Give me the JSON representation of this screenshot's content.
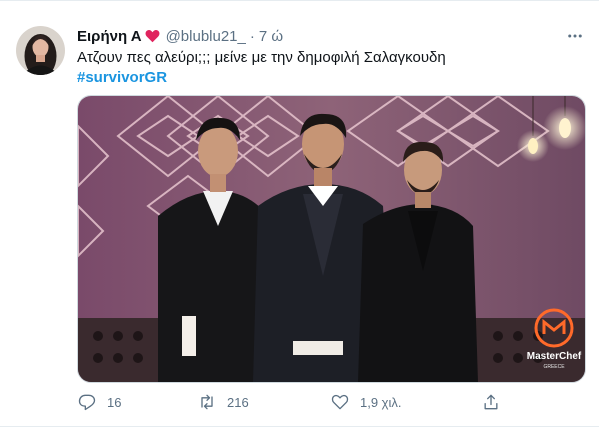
{
  "tweet": {
    "author_name": "Ειρήνη Α",
    "handle": "@blublu21_",
    "separator": "·",
    "time": "7 ώ",
    "text": "Ατζουν πες αλεύρι;;; μείνε με την δημοφιλή Σαλαγκουδη",
    "hashtag": "#survivorGR",
    "media": {
      "logo_title": "MasterChef",
      "logo_subtitle": "GREECE"
    }
  },
  "actions": {
    "replies": "16",
    "retweets": "216",
    "likes": "1,9 χιλ."
  },
  "icons": {
    "heart_emoji": "heart-icon",
    "more": "more-icon",
    "reply": "reply-icon",
    "retweet": "retweet-icon",
    "like": "like-icon",
    "share": "share-icon"
  },
  "colors": {
    "hashtag": "#1b95e0",
    "secondary_text": "#5b7083",
    "heart": "#e0245e",
    "divider": "#e6ecf0"
  }
}
